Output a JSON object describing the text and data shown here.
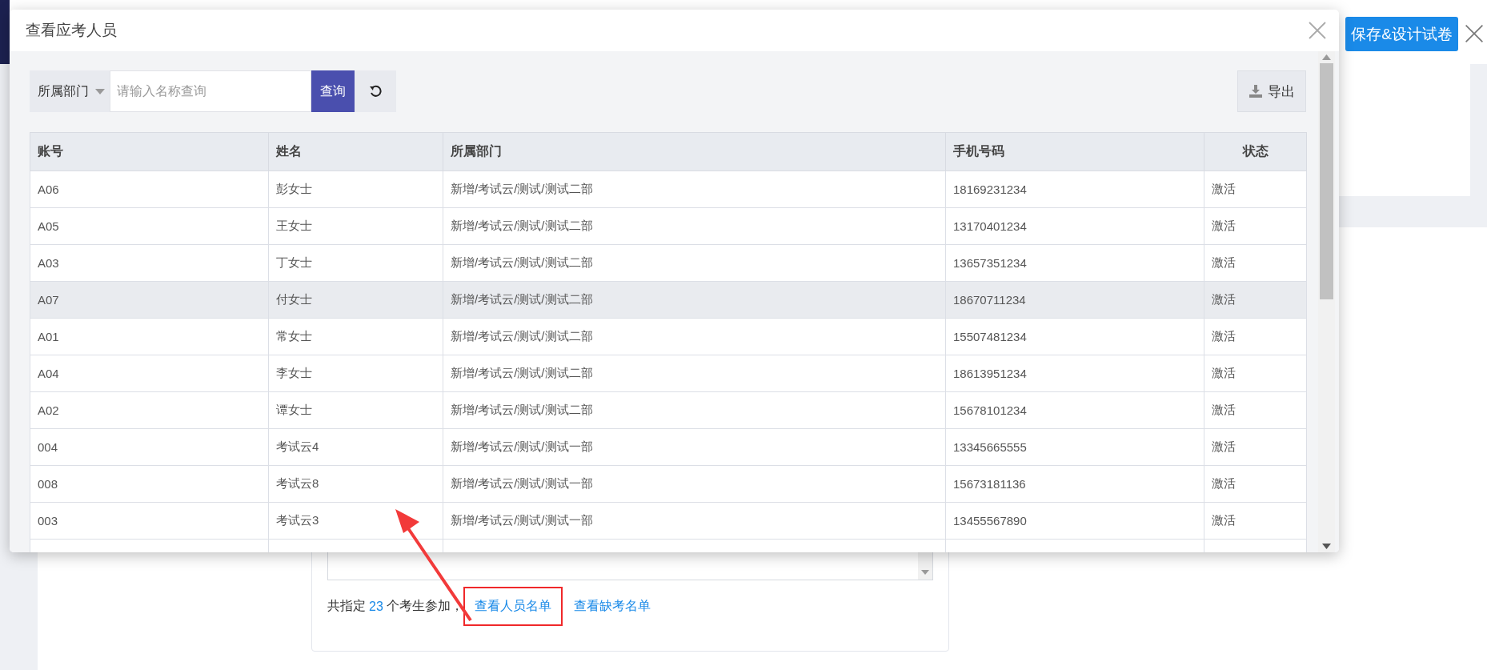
{
  "background": {
    "save_button": "保存&设计试卷",
    "summary": {
      "prefix": "共指定",
      "count": "23",
      "suffix": "个考生参加，"
    },
    "links": [
      {
        "label": "查看人员名单",
        "highlighted": true
      },
      {
        "label": "查看缺考名单",
        "highlighted": false
      }
    ]
  },
  "dialog": {
    "title": "查看应考人员",
    "filter": {
      "department": "所属部门",
      "placeholder": "请输入名称查询",
      "search_button": "查询"
    },
    "export_button": "导出",
    "table": {
      "columns": [
        "账号",
        "姓名",
        "所属部门",
        "手机号码",
        "状态"
      ],
      "rows": [
        {
          "cells": [
            "A06",
            "彭女士",
            "新增/考试云/测试/测试二部",
            "18169231234",
            "激活"
          ],
          "selected": false
        },
        {
          "cells": [
            "A05",
            "王女士",
            "新增/考试云/测试/测试二部",
            "13170401234",
            "激活"
          ],
          "selected": false
        },
        {
          "cells": [
            "A03",
            "丁女士",
            "新增/考试云/测试/测试二部",
            "13657351234",
            "激活"
          ],
          "selected": false
        },
        {
          "cells": [
            "A07",
            "付女士",
            "新增/考试云/测试/测试二部",
            "18670711234",
            "激活"
          ],
          "selected": true
        },
        {
          "cells": [
            "A01",
            "常女士",
            "新增/考试云/测试/测试二部",
            "15507481234",
            "激活"
          ],
          "selected": false
        },
        {
          "cells": [
            "A04",
            "李女士",
            "新增/考试云/测试/测试二部",
            "18613951234",
            "激活"
          ],
          "selected": false
        },
        {
          "cells": [
            "A02",
            "谭女士",
            "新增/考试云/测试/测试二部",
            "15678101234",
            "激活"
          ],
          "selected": false
        },
        {
          "cells": [
            "004",
            "考试云4",
            "新增/考试云/测试/测试一部",
            "13345665555",
            "激活"
          ],
          "selected": false
        },
        {
          "cells": [
            "008",
            "考试云8",
            "新增/考试云/测试/测试一部",
            "15673181136",
            "激活"
          ],
          "selected": false
        },
        {
          "cells": [
            "003",
            "考试云3",
            "新增/考试云/测试/测试一部",
            "13455567890",
            "激活"
          ],
          "selected": false
        }
      ]
    }
  }
}
